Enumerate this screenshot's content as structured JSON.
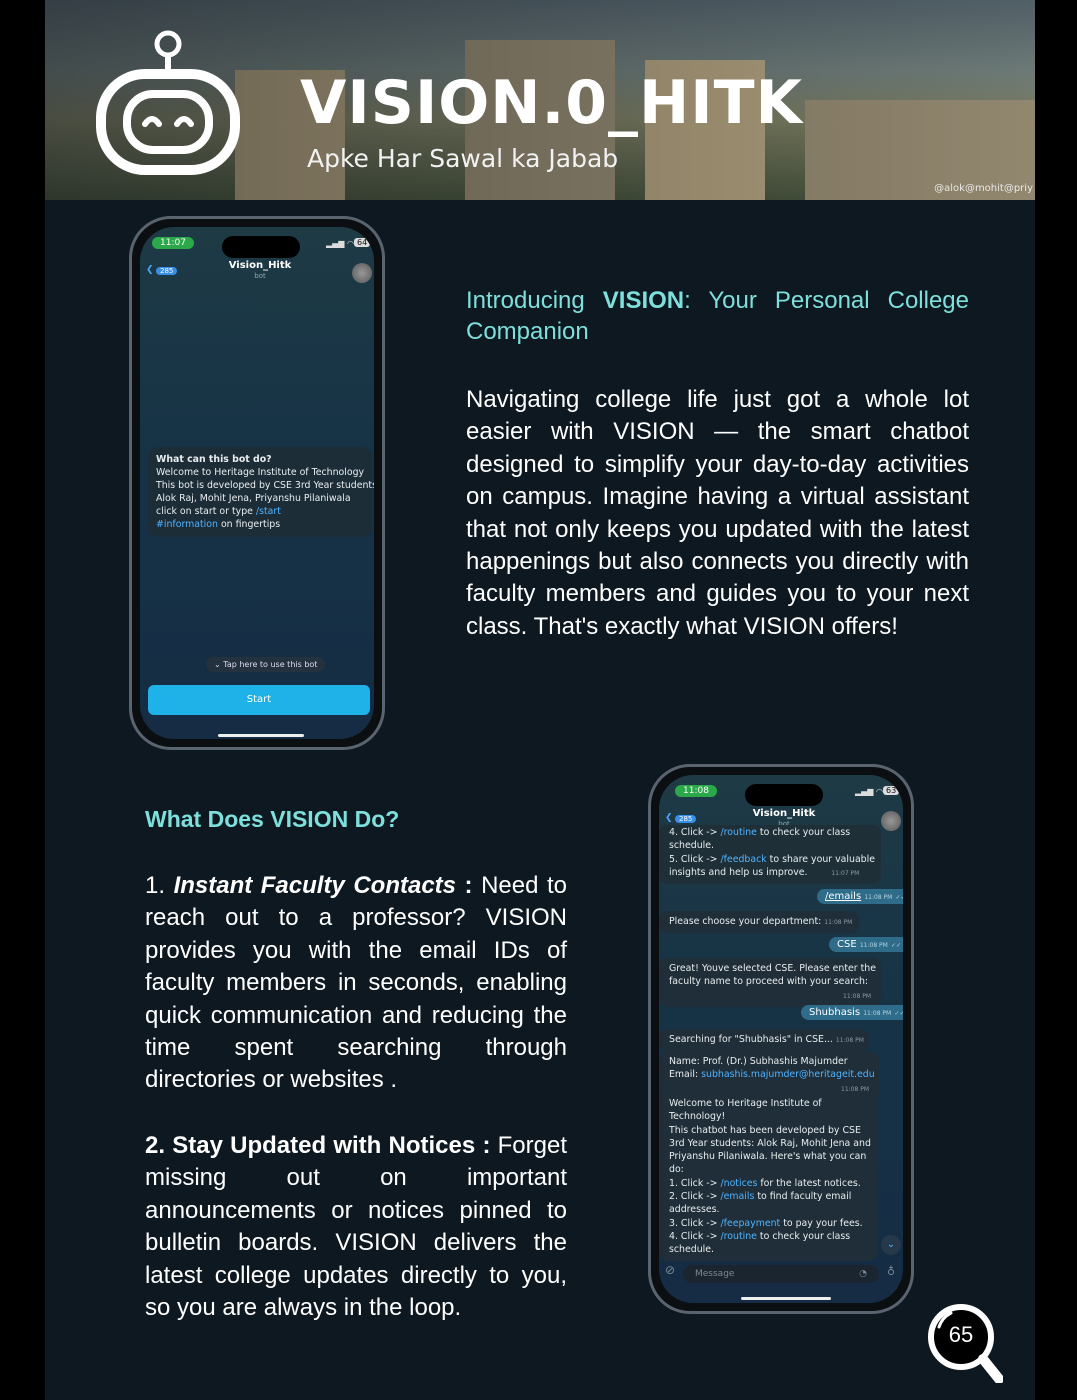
{
  "banner": {
    "title": "VISION.0_HITK",
    "tagline": "Apke Har Sawal ka Jabab",
    "credit": "@alok@mohit@priy"
  },
  "phone1": {
    "time": "11:07",
    "battery": "64",
    "back_count": "285",
    "chat_name": "Vision_Hitk",
    "chat_sub": "bot",
    "bubble": {
      "q": "What can this bot do?",
      "l1": "Welcome to Heritage Institute of Technology",
      "l2": "This bot is developed by CSE 3rd Year students :",
      "l3": "Alok Raj, Mohit Jena, Priyanshu Pilaniwala",
      "l4a": "click on start or type ",
      "l4b": "/start",
      "l5a": "#information",
      "l5b": " on fingertips"
    },
    "tap_hint": "Tap here to use this bot",
    "start_label": "Start"
  },
  "phone2": {
    "time": "11:08",
    "battery": "63",
    "back_count": "285",
    "chat_name": "Vision_Hitk",
    "chat_sub": "bot",
    "m1": {
      "a1": "4. Click -> ",
      "a1l": "/routine",
      "a1b": " to check your class",
      "a2": "schedule.",
      "a3": "5. Click -> ",
      "a3l": "/feedback",
      "a3b": " to share your valuable",
      "a4": "insights and help us improve.",
      "ts": "11:07 PM"
    },
    "o1": {
      "text": "/emails",
      "ts": "11:08 PM"
    },
    "m2": {
      "text": "Please choose your department:",
      "ts": "11:08 PM"
    },
    "o2": {
      "text": "CSE",
      "ts": "11:08 PM"
    },
    "m3": {
      "l1": "Great! Youve selected CSE. Please enter the",
      "l2": "faculty name to proceed with your search:",
      "ts": "11:08 PM"
    },
    "o3": {
      "text": "Shubhasis",
      "ts": "11:08 PM"
    },
    "m4": {
      "text": "Searching for \"Shubhasis\" in CSE...",
      "ts": "11:08 PM"
    },
    "m5": {
      "l1": "Name: Prof. (Dr.) Subhashis Majumder",
      "l2a": "Email: ",
      "l2b": "subhashis.majumder@heritageit.edu",
      "ts": "11:08 PM"
    },
    "m6": {
      "l1": "Welcome to Heritage Institute of",
      "l2": "Technology!",
      "l3": "This chatbot has been developed by CSE",
      "l4": "3rd Year students: Alok Raj, Mohit Jena and",
      "l5": "Priyanshu Pilaniwala. Here's what you can",
      "l6": "do:",
      "l7a": "1. Click -> ",
      "l7l": "/notices",
      "l7b": " for the latest notices.",
      "l8a": "2. Click -> ",
      "l8l": "/emails",
      "l8b": " to find faculty email",
      "l9": "addresses.",
      "l10a": "3. Click -> ",
      "l10l": "/feepayment",
      "l10b": " to pay your fees.",
      "l11a": "4. Click -> ",
      "l11l": "/routine",
      "l11b": " to check your class",
      "l12": "schedule."
    },
    "input_placeholder": "Message"
  },
  "intro": {
    "pre": "Introducing ",
    "brand": "VISION",
    "rest": ": Your Personal College",
    "line2": "Companion"
  },
  "paragraph": "Navigating college life just got a whole lot easier with VISION — the smart chatbot designed to simplify your day-to-day activities on campus. Imagine having a virtual assistant that not only keeps you updated with the latest happenings but also connects you directly with faculty members and guides you to your next class. That's exactly what VISION offers!",
  "section": {
    "heading": "What Does VISION Do?",
    "item1": {
      "num": "1. ",
      "title": "Instant Faculty Contacts",
      "sep": " : ",
      "text": "Need to reach out to a professor? VISION provides you with the email IDs of faculty members in seconds, enabling quick communication and reducing the time spent searching through directories or websites ."
    },
    "item2": {
      "num": "2. ",
      "title": "Stay Updated with Notices",
      "sep": " : ",
      "text": "Forget missing out on important announcements or notices pinned to bulletin boards. VISION delivers the latest college updates directly to you, so you are always in the loop."
    }
  },
  "page_number": "65"
}
